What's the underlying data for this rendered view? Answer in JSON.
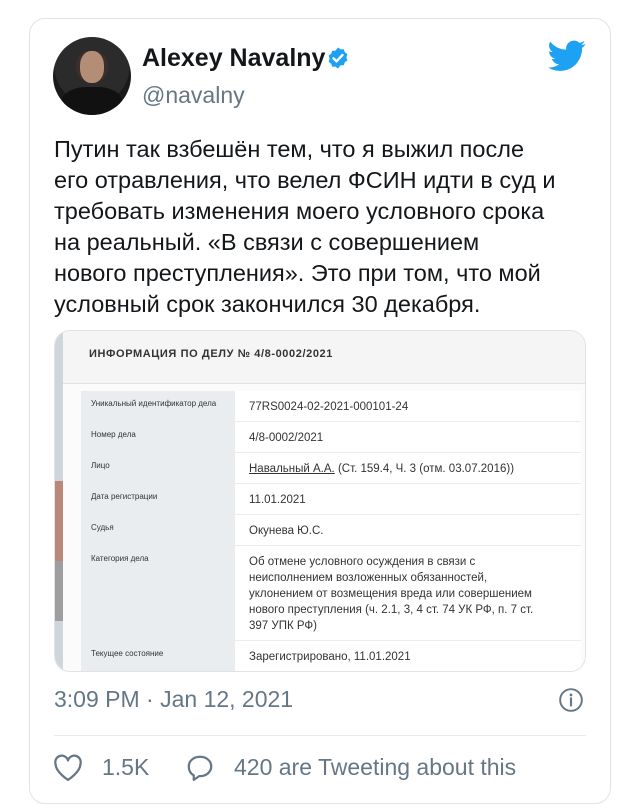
{
  "author": {
    "name": "Alexey Navalny",
    "handle": "@navalny"
  },
  "tweet": {
    "lines": [
      "Путин так взбешён тем, что я выжил после",
      "его отравления, что велел ФСИН идти в суд и",
      "требовать изменения моего условного срока",
      "на реальный. «В связи с совершением",
      "нового преступления». Это при том, что мой",
      "условный срок закончился 30 декабря."
    ]
  },
  "media": {
    "header": "ИНФОРМАЦИЯ ПО ДЕЛУ № 4/8-0002/2021",
    "rows": [
      {
        "key": "Уникальный идентификатор дела",
        "value": "77RS0024-02-2021-000101-24"
      },
      {
        "key": "Номер дела",
        "value": "4/8-0002/2021"
      },
      {
        "key": "Лицо",
        "value_link": "Навальный А.А.",
        "value_rest": " (Ст. 159.4, Ч. 3 (отм. 03.07.2016))"
      },
      {
        "key": "Дата регистрации",
        "value": "11.01.2021"
      },
      {
        "key": "Судья",
        "value": "Окунева Ю.С."
      },
      {
        "key": "Категория дела",
        "value_lines": [
          "Об отмене условного осуждения в связи с",
          "неисполнением возложенных обязанностей,",
          "уклонением от возмещения вреда или совершением",
          "нового преступления (ч. 2.1, 3, 4 ст. 74 УК РФ, п. 7 ст.",
          "397 УПК РФ)"
        ]
      },
      {
        "key": "Текущее состояние",
        "value": "Зарегистрировано, 11.01.2021"
      }
    ]
  },
  "meta": {
    "timestamp": "3:09 PM · Jan 12, 2021",
    "likes": "1.5K",
    "replies": "420 are Tweeting about this"
  },
  "colors": {
    "twitter_blue": "#1da1f2",
    "muted_text": "#657786"
  }
}
